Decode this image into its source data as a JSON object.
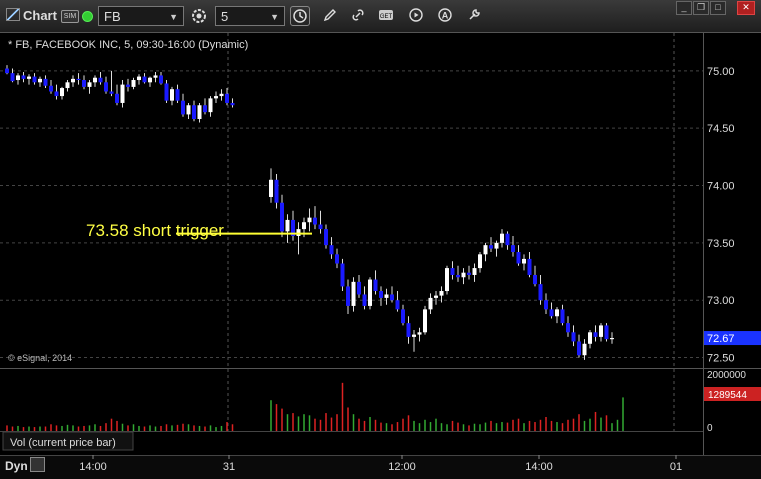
{
  "toolbar": {
    "title": "Chart",
    "sim_label": "SIM",
    "symbol": "FB",
    "interval": "5"
  },
  "chart_header": "* FB, FACEBOOK INC, 5, 09:30-16:00 (Dynamic)",
  "copyright": "© eSignal, 2014",
  "annotation": "73.58 short trigger",
  "volume_label": "Vol (current price bar)",
  "bottom": {
    "mode": "Dyn"
  },
  "colors": {
    "up": "#ffffff",
    "down": "#1a1aff",
    "trigger": "#ffff33",
    "vol_up": "#33aa33",
    "vol_down": "#dd2222",
    "last_price_bg": "#1a33ff",
    "last_vol_bg": "#cc2222"
  },
  "chart_data": {
    "type": "candlestick",
    "y_axis": {
      "ticks": [
        "75.00",
        "74.50",
        "74.00",
        "73.50",
        "73.00",
        "72.50"
      ],
      "ylim": [
        72.4,
        75.33
      ]
    },
    "x_axis": {
      "ticks": [
        "14:00",
        "31",
        "12:00",
        "14:00",
        "01"
      ]
    },
    "last_price": "72.67",
    "trigger_price": 73.58,
    "volume_axis": {
      "ticks": [
        "2000000",
        "0"
      ],
      "last_volume": "1289544"
    },
    "candles": [
      [
        75.02,
        75.05,
        74.97,
        74.98
      ],
      [
        74.98,
        75.02,
        74.9,
        74.91
      ],
      [
        74.92,
        74.98,
        74.88,
        74.96
      ],
      [
        74.96,
        74.99,
        74.9,
        74.93
      ],
      [
        74.93,
        74.97,
        74.88,
        74.95
      ],
      [
        74.95,
        74.98,
        74.88,
        74.9
      ],
      [
        74.9,
        74.95,
        74.86,
        74.93
      ],
      [
        74.93,
        74.96,
        74.85,
        74.87
      ],
      [
        74.87,
        74.92,
        74.8,
        74.82
      ],
      [
        74.82,
        74.88,
        74.75,
        74.78
      ],
      [
        74.78,
        74.86,
        74.75,
        74.85
      ],
      [
        74.85,
        74.92,
        74.82,
        74.9
      ],
      [
        74.9,
        74.96,
        74.86,
        74.93
      ],
      [
        74.93,
        74.98,
        74.88,
        74.92
      ],
      [
        74.92,
        74.96,
        74.84,
        74.86
      ],
      [
        74.86,
        74.92,
        74.8,
        74.9
      ],
      [
        74.9,
        74.96,
        74.86,
        74.94
      ],
      [
        74.94,
        74.99,
        74.88,
        74.9
      ],
      [
        74.9,
        74.95,
        74.8,
        74.82
      ],
      [
        74.82,
        75.0,
        74.78,
        74.8
      ],
      [
        74.8,
        74.88,
        74.7,
        74.72
      ],
      [
        74.72,
        74.92,
        74.68,
        74.88
      ],
      [
        74.88,
        74.93,
        74.82,
        74.86
      ],
      [
        74.86,
        74.94,
        74.84,
        74.92
      ],
      [
        74.92,
        74.97,
        74.88,
        74.95
      ],
      [
        74.95,
        74.98,
        74.89,
        74.9
      ],
      [
        74.9,
        74.95,
        74.86,
        74.94
      ],
      [
        74.94,
        74.99,
        74.9,
        74.96
      ],
      [
        74.96,
        74.99,
        74.88,
        74.89
      ],
      [
        74.89,
        74.92,
        74.72,
        74.74
      ],
      [
        74.74,
        74.86,
        74.7,
        74.84
      ],
      [
        74.84,
        74.88,
        74.72,
        74.74
      ],
      [
        74.74,
        74.8,
        74.6,
        74.62
      ],
      [
        74.62,
        74.72,
        74.58,
        74.7
      ],
      [
        74.7,
        74.74,
        74.56,
        74.58
      ],
      [
        74.58,
        74.72,
        74.55,
        74.7
      ],
      [
        74.7,
        74.76,
        74.62,
        74.64
      ],
      [
        74.64,
        74.78,
        74.6,
        74.76
      ],
      [
        74.76,
        74.82,
        74.72,
        74.78
      ],
      [
        74.78,
        74.84,
        74.74,
        74.8
      ],
      [
        74.8,
        74.85,
        74.7,
        74.72
      ],
      [
        74.72,
        74.76,
        74.68,
        74.7
      ],
      [
        73.9,
        74.15,
        73.85,
        74.05
      ],
      [
        74.05,
        74.1,
        73.8,
        73.85
      ],
      [
        73.85,
        73.92,
        73.55,
        73.6
      ],
      [
        73.6,
        73.75,
        73.5,
        73.7
      ],
      [
        73.7,
        73.78,
        73.52,
        73.56
      ],
      [
        73.56,
        73.68,
        73.4,
        73.62
      ],
      [
        73.62,
        73.72,
        73.55,
        73.68
      ],
      [
        73.68,
        73.8,
        73.6,
        73.72
      ],
      [
        73.72,
        73.82,
        73.62,
        73.66
      ],
      [
        73.66,
        73.78,
        73.58,
        73.62
      ],
      [
        73.62,
        73.66,
        73.45,
        73.48
      ],
      [
        73.48,
        73.55,
        73.36,
        73.4
      ],
      [
        73.4,
        73.45,
        73.28,
        73.32
      ],
      [
        73.32,
        73.36,
        73.08,
        73.12
      ],
      [
        73.12,
        73.18,
        72.88,
        72.95
      ],
      [
        72.95,
        73.2,
        72.9,
        73.16
      ],
      [
        73.16,
        73.22,
        73.02,
        73.05
      ],
      [
        73.05,
        73.12,
        72.92,
        72.95
      ],
      [
        72.95,
        73.2,
        72.92,
        73.18
      ],
      [
        73.18,
        73.26,
        73.05,
        73.08
      ],
      [
        73.08,
        73.12,
        72.95,
        73.02
      ],
      [
        73.02,
        73.1,
        72.96,
        73.05
      ],
      [
        73.05,
        73.12,
        72.98,
        73.0
      ],
      [
        73.0,
        73.08,
        72.9,
        72.92
      ],
      [
        72.92,
        72.96,
        72.78,
        72.8
      ],
      [
        72.8,
        72.86,
        72.62,
        72.68
      ],
      [
        72.68,
        72.74,
        72.55,
        72.7
      ],
      [
        72.7,
        72.76,
        72.64,
        72.72
      ],
      [
        72.72,
        72.95,
        72.7,
        72.92
      ],
      [
        72.92,
        73.06,
        72.88,
        73.02
      ],
      [
        73.02,
        73.08,
        72.96,
        73.04
      ],
      [
        73.04,
        73.12,
        72.98,
        73.08
      ],
      [
        73.08,
        73.3,
        73.05,
        73.28
      ],
      [
        73.28,
        73.34,
        73.18,
        73.22
      ],
      [
        73.22,
        73.3,
        73.16,
        73.2
      ],
      [
        73.2,
        73.28,
        73.14,
        73.24
      ],
      [
        73.24,
        73.3,
        73.18,
        73.22
      ],
      [
        73.22,
        73.32,
        73.16,
        73.28
      ],
      [
        73.28,
        73.42,
        73.24,
        73.4
      ],
      [
        73.4,
        73.5,
        73.34,
        73.48
      ],
      [
        73.48,
        73.55,
        73.42,
        73.45
      ],
      [
        73.45,
        73.52,
        73.38,
        73.5
      ],
      [
        73.5,
        73.62,
        73.46,
        73.58
      ],
      [
        73.58,
        73.6,
        73.44,
        73.48
      ],
      [
        73.48,
        73.56,
        73.38,
        73.42
      ],
      [
        73.42,
        73.48,
        73.3,
        73.32
      ],
      [
        73.32,
        73.4,
        73.26,
        73.36
      ],
      [
        73.36,
        73.42,
        73.2,
        73.22
      ],
      [
        73.22,
        73.3,
        73.12,
        73.14
      ],
      [
        73.14,
        73.22,
        72.96,
        73.0
      ],
      [
        73.0,
        73.06,
        72.88,
        72.92
      ],
      [
        72.92,
        72.98,
        72.84,
        72.86
      ],
      [
        72.86,
        72.94,
        72.8,
        72.92
      ],
      [
        72.92,
        72.96,
        72.78,
        72.8
      ],
      [
        72.8,
        72.86,
        72.68,
        72.72
      ],
      [
        72.72,
        72.78,
        72.6,
        72.64
      ],
      [
        72.64,
        72.7,
        72.5,
        72.52
      ],
      [
        72.52,
        72.66,
        72.48,
        72.62
      ],
      [
        72.62,
        72.74,
        72.58,
        72.72
      ],
      [
        72.72,
        72.78,
        72.64,
        72.68
      ],
      [
        72.68,
        72.8,
        72.64,
        72.78
      ],
      [
        72.78,
        72.8,
        72.64,
        72.66
      ],
      [
        72.66,
        72.72,
        72.62,
        72.67
      ]
    ],
    "volumes": [
      0.1,
      0.08,
      0.09,
      0.07,
      0.08,
      0.07,
      0.08,
      0.08,
      0.12,
      0.1,
      0.09,
      0.11,
      0.1,
      0.08,
      0.09,
      0.1,
      0.12,
      0.09,
      0.14,
      0.22,
      0.18,
      0.13,
      0.1,
      0.12,
      0.09,
      0.08,
      0.1,
      0.08,
      0.09,
      0.12,
      0.1,
      0.11,
      0.13,
      0.12,
      0.1,
      0.09,
      0.08,
      0.1,
      0.07,
      0.09,
      0.16,
      0.12,
      0.55,
      0.48,
      0.4,
      0.3,
      0.32,
      0.26,
      0.3,
      0.28,
      0.22,
      0.2,
      0.32,
      0.24,
      0.3,
      0.86,
      0.42,
      0.3,
      0.22,
      0.18,
      0.25,
      0.2,
      0.15,
      0.14,
      0.12,
      0.16,
      0.22,
      0.28,
      0.18,
      0.14,
      0.2,
      0.16,
      0.22,
      0.14,
      0.12,
      0.18,
      0.15,
      0.12,
      0.1,
      0.13,
      0.12,
      0.15,
      0.18,
      0.14,
      0.16,
      0.15,
      0.2,
      0.22,
      0.14,
      0.18,
      0.16,
      0.2,
      0.25,
      0.18,
      0.16,
      0.14,
      0.2,
      0.22,
      0.3,
      0.18,
      0.22,
      0.34,
      0.24,
      0.28,
      0.14,
      0.2,
      0.6
    ]
  }
}
